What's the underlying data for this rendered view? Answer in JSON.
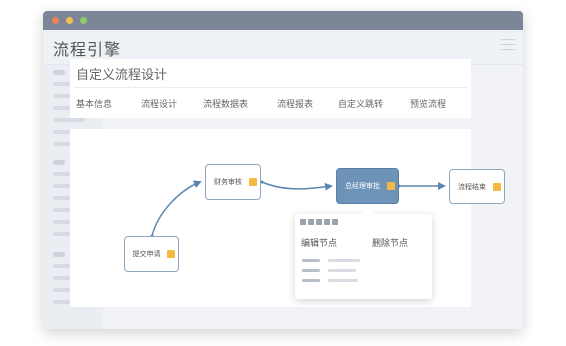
{
  "app": {
    "title": "流程引擎"
  },
  "page": {
    "title": "自定义流程设计"
  },
  "tabs": [
    "基本信息",
    "流程设计",
    "流程数据表",
    "流程报表",
    "自定义跳转",
    "预览流程"
  ],
  "flow": {
    "nodes": [
      "提交申请",
      "财务审核",
      "总经理审批",
      "流程结束"
    ],
    "active_node": "总经理审批"
  },
  "context_menu": {
    "items": [
      "编辑节点",
      "删除节点"
    ]
  },
  "colors": {
    "titlebar": "#7c8696",
    "window_dots": [
      "#f0815f",
      "#f4c04f",
      "#8fcb6a"
    ],
    "node_border": "#8fa7bd",
    "active_node": "#6d93b8",
    "node_flag": "#f4b942",
    "connector": "#5b87b0"
  }
}
